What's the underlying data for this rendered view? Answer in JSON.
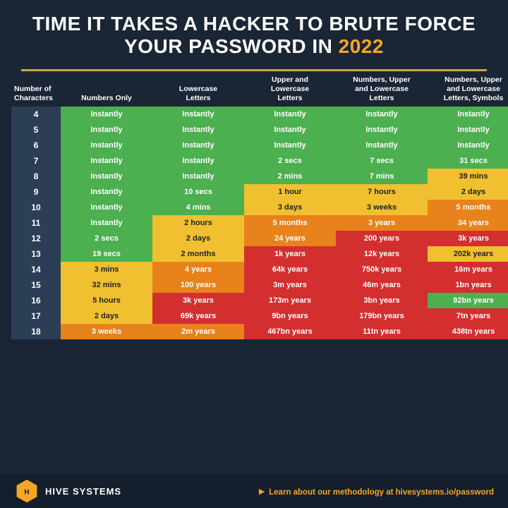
{
  "header": {
    "title_white": "TIME IT TAKES A HACKER TO BRUTE FORCE YOUR PASSWORD IN ",
    "title_year": "2022"
  },
  "columns": [
    "Number of Characters",
    "Numbers Only",
    "Lowercase Letters",
    "Upper and Lowercase Letters",
    "Numbers, Upper and Lowercase Letters",
    "Numbers, Upper and Lowercase Letters, Symbols"
  ],
  "rows": [
    {
      "chars": "4",
      "c1": "Instantly",
      "c2": "Instantly",
      "c3": "Instantly",
      "c4": "Instantly",
      "c5": "Instantly",
      "col1": "green",
      "col2": "green",
      "col3": "green",
      "col4": "green",
      "col5": "green"
    },
    {
      "chars": "5",
      "c1": "Instantly",
      "c2": "Instantly",
      "c3": "Instantly",
      "c4": "Instantly",
      "c5": "Instantly",
      "col1": "green",
      "col2": "green",
      "col3": "green",
      "col4": "green",
      "col5": "green"
    },
    {
      "chars": "6",
      "c1": "Instantly",
      "c2": "Instantly",
      "c3": "Instantly",
      "c4": "Instantly",
      "c5": "Instantly",
      "col1": "green",
      "col2": "green",
      "col3": "green",
      "col4": "green",
      "col5": "green"
    },
    {
      "chars": "7",
      "c1": "Instantly",
      "c2": "Instantly",
      "c3": "2 secs",
      "c4": "7 secs",
      "c5": "31 secs",
      "col1": "green",
      "col2": "green",
      "col3": "green",
      "col4": "green",
      "col5": "green"
    },
    {
      "chars": "8",
      "c1": "Instantly",
      "c2": "Instantly",
      "c3": "2 mins",
      "c4": "7 mins",
      "c5": "39 mins",
      "col1": "green",
      "col2": "green",
      "col3": "green",
      "col4": "green",
      "col5": "yellow"
    },
    {
      "chars": "9",
      "c1": "Instantly",
      "c2": "10 secs",
      "c3": "1 hour",
      "c4": "7 hours",
      "c5": "2 days",
      "col1": "green",
      "col2": "green",
      "col3": "yellow",
      "col4": "yellow",
      "col5": "yellow"
    },
    {
      "chars": "10",
      "c1": "Instantly",
      "c2": "4 mins",
      "c3": "3 days",
      "c4": "3 weeks",
      "c5": "5 months",
      "col1": "green",
      "col2": "green",
      "col3": "yellow",
      "col4": "yellow",
      "col5": "orange"
    },
    {
      "chars": "11",
      "c1": "Instantly",
      "c2": "2 hours",
      "c3": "5 months",
      "c4": "3 years",
      "c5": "34 years",
      "col1": "green",
      "col2": "yellow",
      "col3": "orange",
      "col4": "orange",
      "col5": "orange"
    },
    {
      "chars": "12",
      "c1": "2 secs",
      "c2": "2 days",
      "c3": "24 years",
      "c4": "200 years",
      "c5": "3k years",
      "col1": "green",
      "col2": "yellow",
      "col3": "orange",
      "col4": "red",
      "col5": "red"
    },
    {
      "chars": "13",
      "c1": "19 secs",
      "c2": "2 months",
      "c3": "1k years",
      "c4": "12k years",
      "c5": "202k years",
      "col1": "green",
      "col2": "yellow",
      "col3": "red",
      "col4": "red",
      "col5": "yellow"
    },
    {
      "chars": "14",
      "c1": "3 mins",
      "c2": "4 years",
      "c3": "64k years",
      "c4": "750k years",
      "c5": "16m years",
      "col1": "yellow",
      "col2": "orange",
      "col3": "red",
      "col4": "red",
      "col5": "red"
    },
    {
      "chars": "15",
      "c1": "32 mins",
      "c2": "100 years",
      "c3": "3m years",
      "c4": "46m years",
      "c5": "1bn years",
      "col1": "yellow",
      "col2": "orange",
      "col3": "red",
      "col4": "red",
      "col5": "red"
    },
    {
      "chars": "16",
      "c1": "5 hours",
      "c2": "3k years",
      "c3": "173m years",
      "c4": "3bn years",
      "c5": "92bn years",
      "col1": "yellow",
      "col2": "red",
      "col3": "red",
      "col4": "red",
      "col5": "green"
    },
    {
      "chars": "17",
      "c1": "2 days",
      "c2": "69k years",
      "c3": "9bn years",
      "c4": "179bn years",
      "c5": "7tn years",
      "col1": "yellow",
      "col2": "red",
      "col3": "red",
      "col4": "red",
      "col5": "red"
    },
    {
      "chars": "18",
      "c1": "3 weeks",
      "c2": "2m years",
      "c3": "467bn years",
      "c4": "11tn years",
      "c5": "438tn years",
      "col1": "orange",
      "col2": "orange",
      "col3": "red",
      "col4": "red",
      "col5": "red"
    }
  ],
  "footer": {
    "brand": "HIVE SYSTEMS",
    "cta_text": " Learn about our methodology at ",
    "cta_link": "hivesystems.io/password"
  }
}
